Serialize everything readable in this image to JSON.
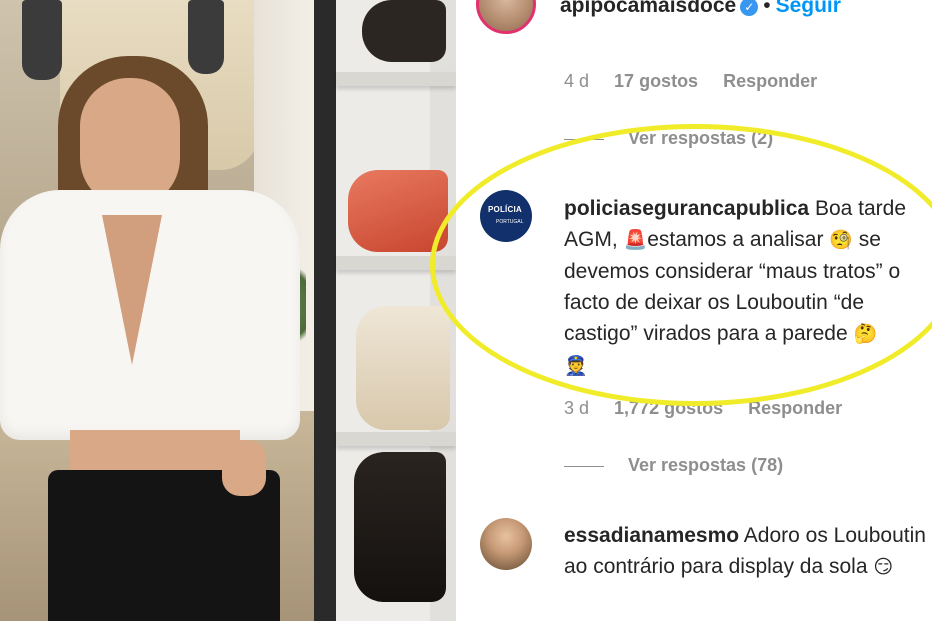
{
  "post": {
    "owner_username": "apipocamaisdoce",
    "follow_label": "Seguir",
    "separator": "•"
  },
  "comments": [
    {
      "age": "4 d",
      "likes": "17 gostos",
      "reply_label": "Responder",
      "replies_label": "Ver respostas (2)"
    },
    {
      "username": "policiasegurancapublica",
      "text_parts": [
        "Boa tarde AGM, ",
        "🚨",
        "estamos a analisar ",
        "🧐",
        " se devemos considerar “maus tratos” o facto de deixar os Louboutin “de castigo” virados para a parede ",
        "🤔",
        " ",
        "👮"
      ],
      "avatar_logo_text": "POLÍCIA",
      "avatar_logo_sub": "PORTUGAL",
      "age": "3 d",
      "likes": "1,772 gostos",
      "reply_label": "Responder",
      "replies_label": "Ver respostas (78)"
    },
    {
      "username": "essadianamesmo",
      "text_parts": [
        "Adoro os Louboutin ao contrário para display da sola ",
        "😏"
      ]
    }
  ],
  "icons": {
    "verified": "verified-badge-icon"
  },
  "colors": {
    "highlight": "#f1ec2a",
    "link_blue": "#0095f6",
    "meta_gray": "#8e8e8e",
    "text": "#262626"
  }
}
